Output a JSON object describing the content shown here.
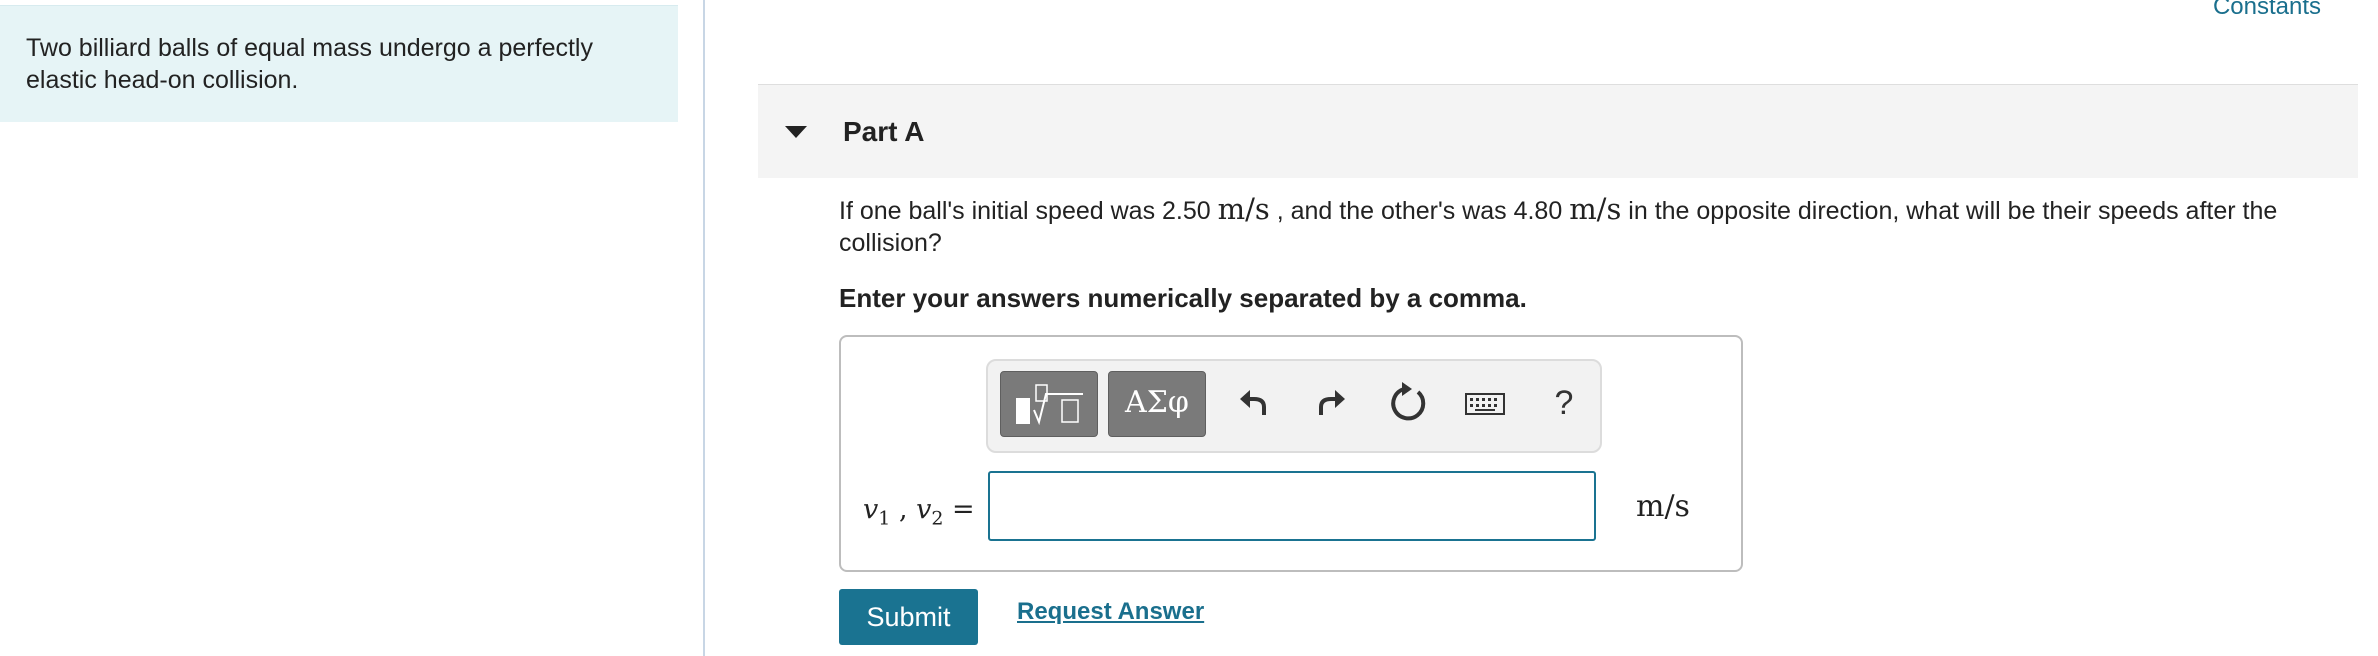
{
  "header": {
    "constants_link": "Constants"
  },
  "problem": {
    "text": "Two billiard balls of equal mass undergo a perfectly elastic head-on collision."
  },
  "part": {
    "title": "Part A",
    "question_parts": [
      "If one ball's initial speed was 2.50 ",
      "m/s",
      " , and the other's was 4.80 ",
      "m/s",
      " in the opposite direction, what will be their speeds after the collision?"
    ],
    "instruction": "Enter your answers numerically separated by a comma."
  },
  "toolbar": {
    "greek_label": "ΑΣφ",
    "help_label": "?"
  },
  "answer": {
    "label_v": "v",
    "label_sub1": "1",
    "label_sep": " , ",
    "label_sub2": "2",
    "label_eq": " =",
    "input_value": "",
    "unit": "m/s"
  },
  "actions": {
    "submit_label": "Submit",
    "request_label": "Request Answer"
  }
}
